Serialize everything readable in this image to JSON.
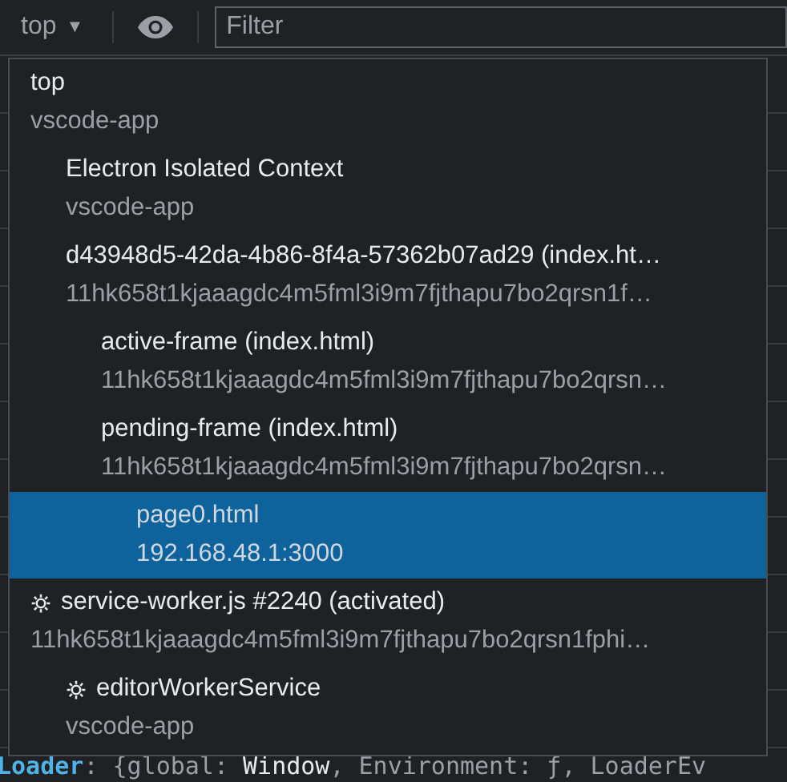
{
  "toolbar": {
    "context": "top",
    "caret": "▼",
    "filter": {
      "placeholder": "Filter"
    }
  },
  "contexts": [
    {
      "title": "top",
      "subtitle": "vscode-app",
      "kind": "frame",
      "selected": false,
      "children": [
        {
          "title": "Electron Isolated Context",
          "subtitle": "vscode-app",
          "kind": "frame",
          "selected": false
        },
        {
          "title": "d43948d5-42da-4b86-8f4a-57362b07ad29 (index.ht…",
          "subtitle": "11hk658t1kjaaagdc4m5fml3i9m7fjthapu7bo2qrsn1f…",
          "kind": "frame",
          "selected": false,
          "children": [
            {
              "title": "active-frame (index.html)",
              "subtitle": "11hk658t1kjaaagdc4m5fml3i9m7fjthapu7bo2qrsn…",
              "kind": "frame",
              "selected": false
            },
            {
              "title": "pending-frame (index.html)",
              "subtitle": "11hk658t1kjaaagdc4m5fml3i9m7fjthapu7bo2qrsn…",
              "kind": "frame",
              "selected": false,
              "children": [
                {
                  "title": "page0.html",
                  "subtitle": "192.168.48.1:3000",
                  "kind": "frame",
                  "selected": true
                }
              ]
            }
          ]
        }
      ]
    },
    {
      "title": "service-worker.js #2240 (activated)",
      "subtitle": "11hk658t1kjaaagdc4m5fml3i9m7fjthapu7bo2qrsn1fphi…",
      "kind": "worker",
      "selected": false,
      "children": [
        {
          "title": "editorWorkerService",
          "subtitle": "vscode-app",
          "kind": "worker",
          "selected": false
        }
      ]
    }
  ],
  "console_line": {
    "name": "Loader",
    "rest": ": {global: ",
    "type": "Window",
    "rest2": ", Environment: ƒ, LoaderEv"
  }
}
